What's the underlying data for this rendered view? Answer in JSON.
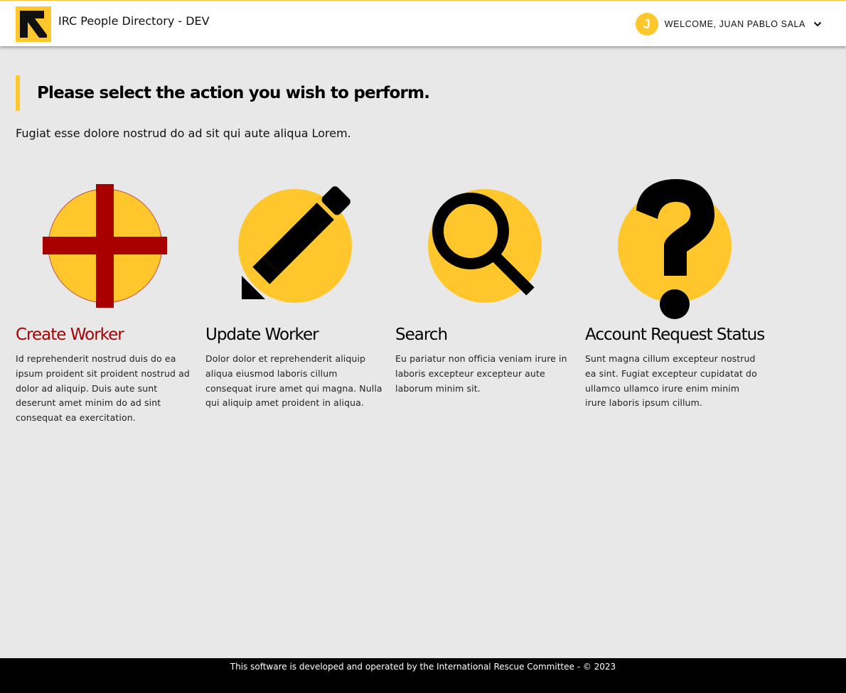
{
  "header": {
    "app_title": "IRC People Directory - DEV",
    "avatar_initial": "J",
    "welcome_text": "WELCOME, JUAN PABLO SALA",
    "accent_color": "#ffc72c",
    "logo_icon": "irc-arrow-logo",
    "dropdown_icon": "chevron-down-icon"
  },
  "main": {
    "heading": "Please select the action you wish to perform.",
    "intro": "Fugiat esse dolore nostrud do ad sit qui aute aliqua Lorem."
  },
  "actions": [
    {
      "title": "Create Worker",
      "description": "Id reprehenderit nostrud duis do ea ipsum proident sit proident nostrud ad dolor ad aliquip. Duis aute sunt deserunt amet minim do ad sint consequat ea exercitation.",
      "icon": "plus-icon",
      "highlighted": true
    },
    {
      "title": "Update Worker",
      "description": "Dolor dolor et reprehenderit aliquip aliqua eiusmod laboris cillum consequat irure amet qui magna. Nulla qui aliquip amet proident in aliqua.",
      "icon": "pencil-icon",
      "highlighted": false
    },
    {
      "title": "Search",
      "description": "Eu pariatur non officia veniam irure in laboris excepteur excepteur aute laborum minim sit.",
      "icon": "magnifier-icon",
      "highlighted": false
    },
    {
      "title": "Account Request Status",
      "description": "Sunt magna cillum excepteur nostrud ea sint. Fugiat excepteur cupidatat do ullamco ullamco irure enim minim irure laboris ipsum cillum.",
      "icon": "question-mark-icon",
      "highlighted": false
    }
  ],
  "colors": {
    "highlight": "#a80000",
    "circle": "#ffc72c",
    "background": "#e8e8e8"
  },
  "footer": {
    "text": "This software is developed and operated by the International Rescue Committee - © 2023"
  }
}
